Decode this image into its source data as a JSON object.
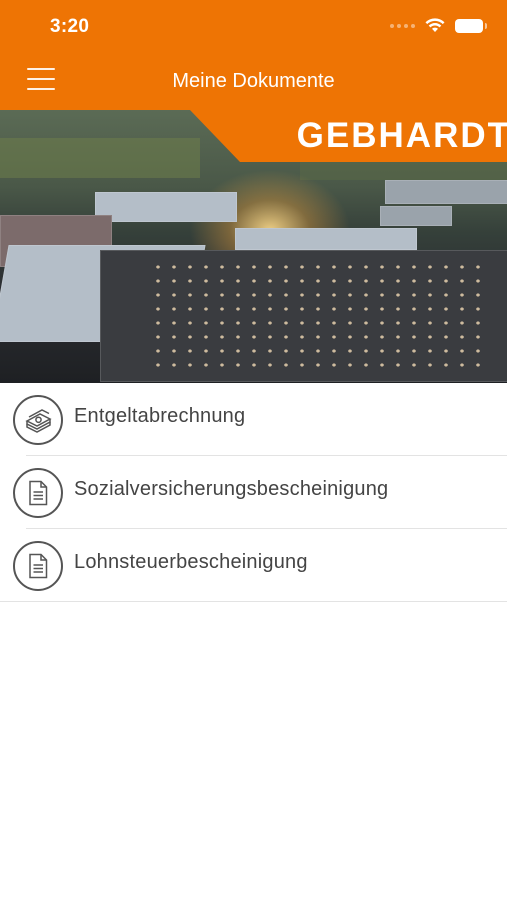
{
  "status_bar": {
    "time": "3:20"
  },
  "header": {
    "title": "Meine Dokumente",
    "menu_icon": "hamburger-menu-icon"
  },
  "hero": {
    "brand": "GEBHARDT",
    "brand_color": "#ee7404"
  },
  "documents": [
    {
      "label": "Entgeltabrechnung",
      "icon": "money-stack-icon"
    },
    {
      "label": "Sozialversicherungsbescheinigung",
      "icon": "document-icon"
    },
    {
      "label": "Lohnsteuerbescheinigung",
      "icon": "document-icon"
    }
  ]
}
